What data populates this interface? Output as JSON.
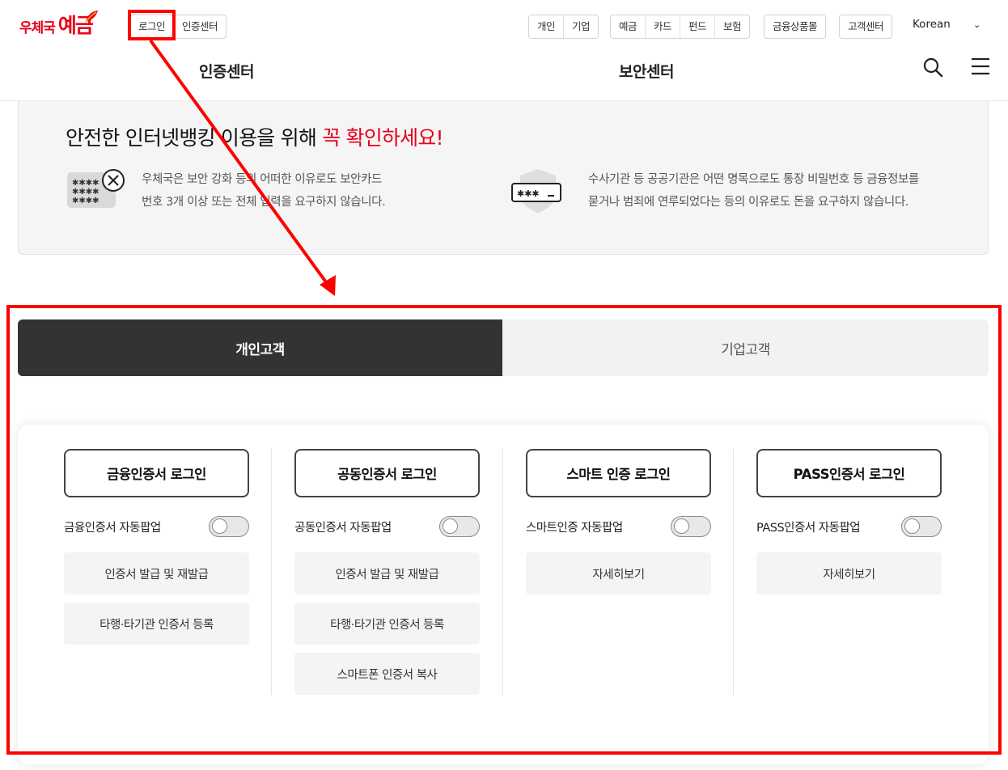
{
  "header": {
    "logo": {
      "prefix": "우체국",
      "main": "예금"
    },
    "auth_links": [
      "로그인",
      "인증센터"
    ],
    "customer_type": [
      "개인",
      "기업"
    ],
    "product_menu": [
      "예금",
      "카드",
      "펀드",
      "보험"
    ],
    "finance_products": "금융상품몰",
    "customer_center": "고객센터",
    "language": "Korean"
  },
  "nav": {
    "cert_center": "인증센터",
    "security_center": "보안센터"
  },
  "notice": {
    "title_prefix": "안전한 인터넷뱅킹 이용을 위해 ",
    "title_emphasis": "꼭 확인하세요!",
    "items": [
      {
        "line1": "우체국은 보안 강화 등의 어떠한 이유로도 보안카드",
        "line2": "번호 3개 이상 또는 전체 입력을 요구하지 않습니다.",
        "icon": "security-card-icon"
      },
      {
        "line1": "수사기관 등 공공기관은 어떤 명목으로도 통장 비밀번호 등 금융정보를",
        "line2": "묻거나 범죄에 연루되었다는 등의 이유로도 돈을 요구하지 않습니다.",
        "icon": "password-shield-icon"
      }
    ]
  },
  "tabs": [
    {
      "label": "개인고객",
      "active": true
    },
    {
      "label": "기업고객",
      "active": false
    }
  ],
  "login_columns": [
    {
      "login_label": "금융인증서 로그인",
      "toggle_label": "금융인증서 자동팝업",
      "toggle_on": false,
      "links": [
        "인증서 발급 및 재발급",
        "타행·타기관 인증서 등록"
      ]
    },
    {
      "login_label": "공동인증서 로그인",
      "toggle_label": "공동인증서 자동팝업",
      "toggle_on": false,
      "links": [
        "인증서 발급 및 재발급",
        "타행·타기관 인증서 등록",
        "스마트폰 인증서 복사"
      ]
    },
    {
      "login_label": "스마트 인증 로그인",
      "toggle_label": "스마트인증 자동팝업",
      "toggle_on": false,
      "links": [
        "자세히보기"
      ]
    },
    {
      "login_label": "PASS인증서 로그인",
      "toggle_label": "PASS인증서 자동팝업",
      "toggle_on": false,
      "links": [
        "자세히보기"
      ]
    }
  ],
  "colors": {
    "brand_red": "#e8001c",
    "tab_active_bg": "#333333",
    "annotation": "#ff0000"
  }
}
